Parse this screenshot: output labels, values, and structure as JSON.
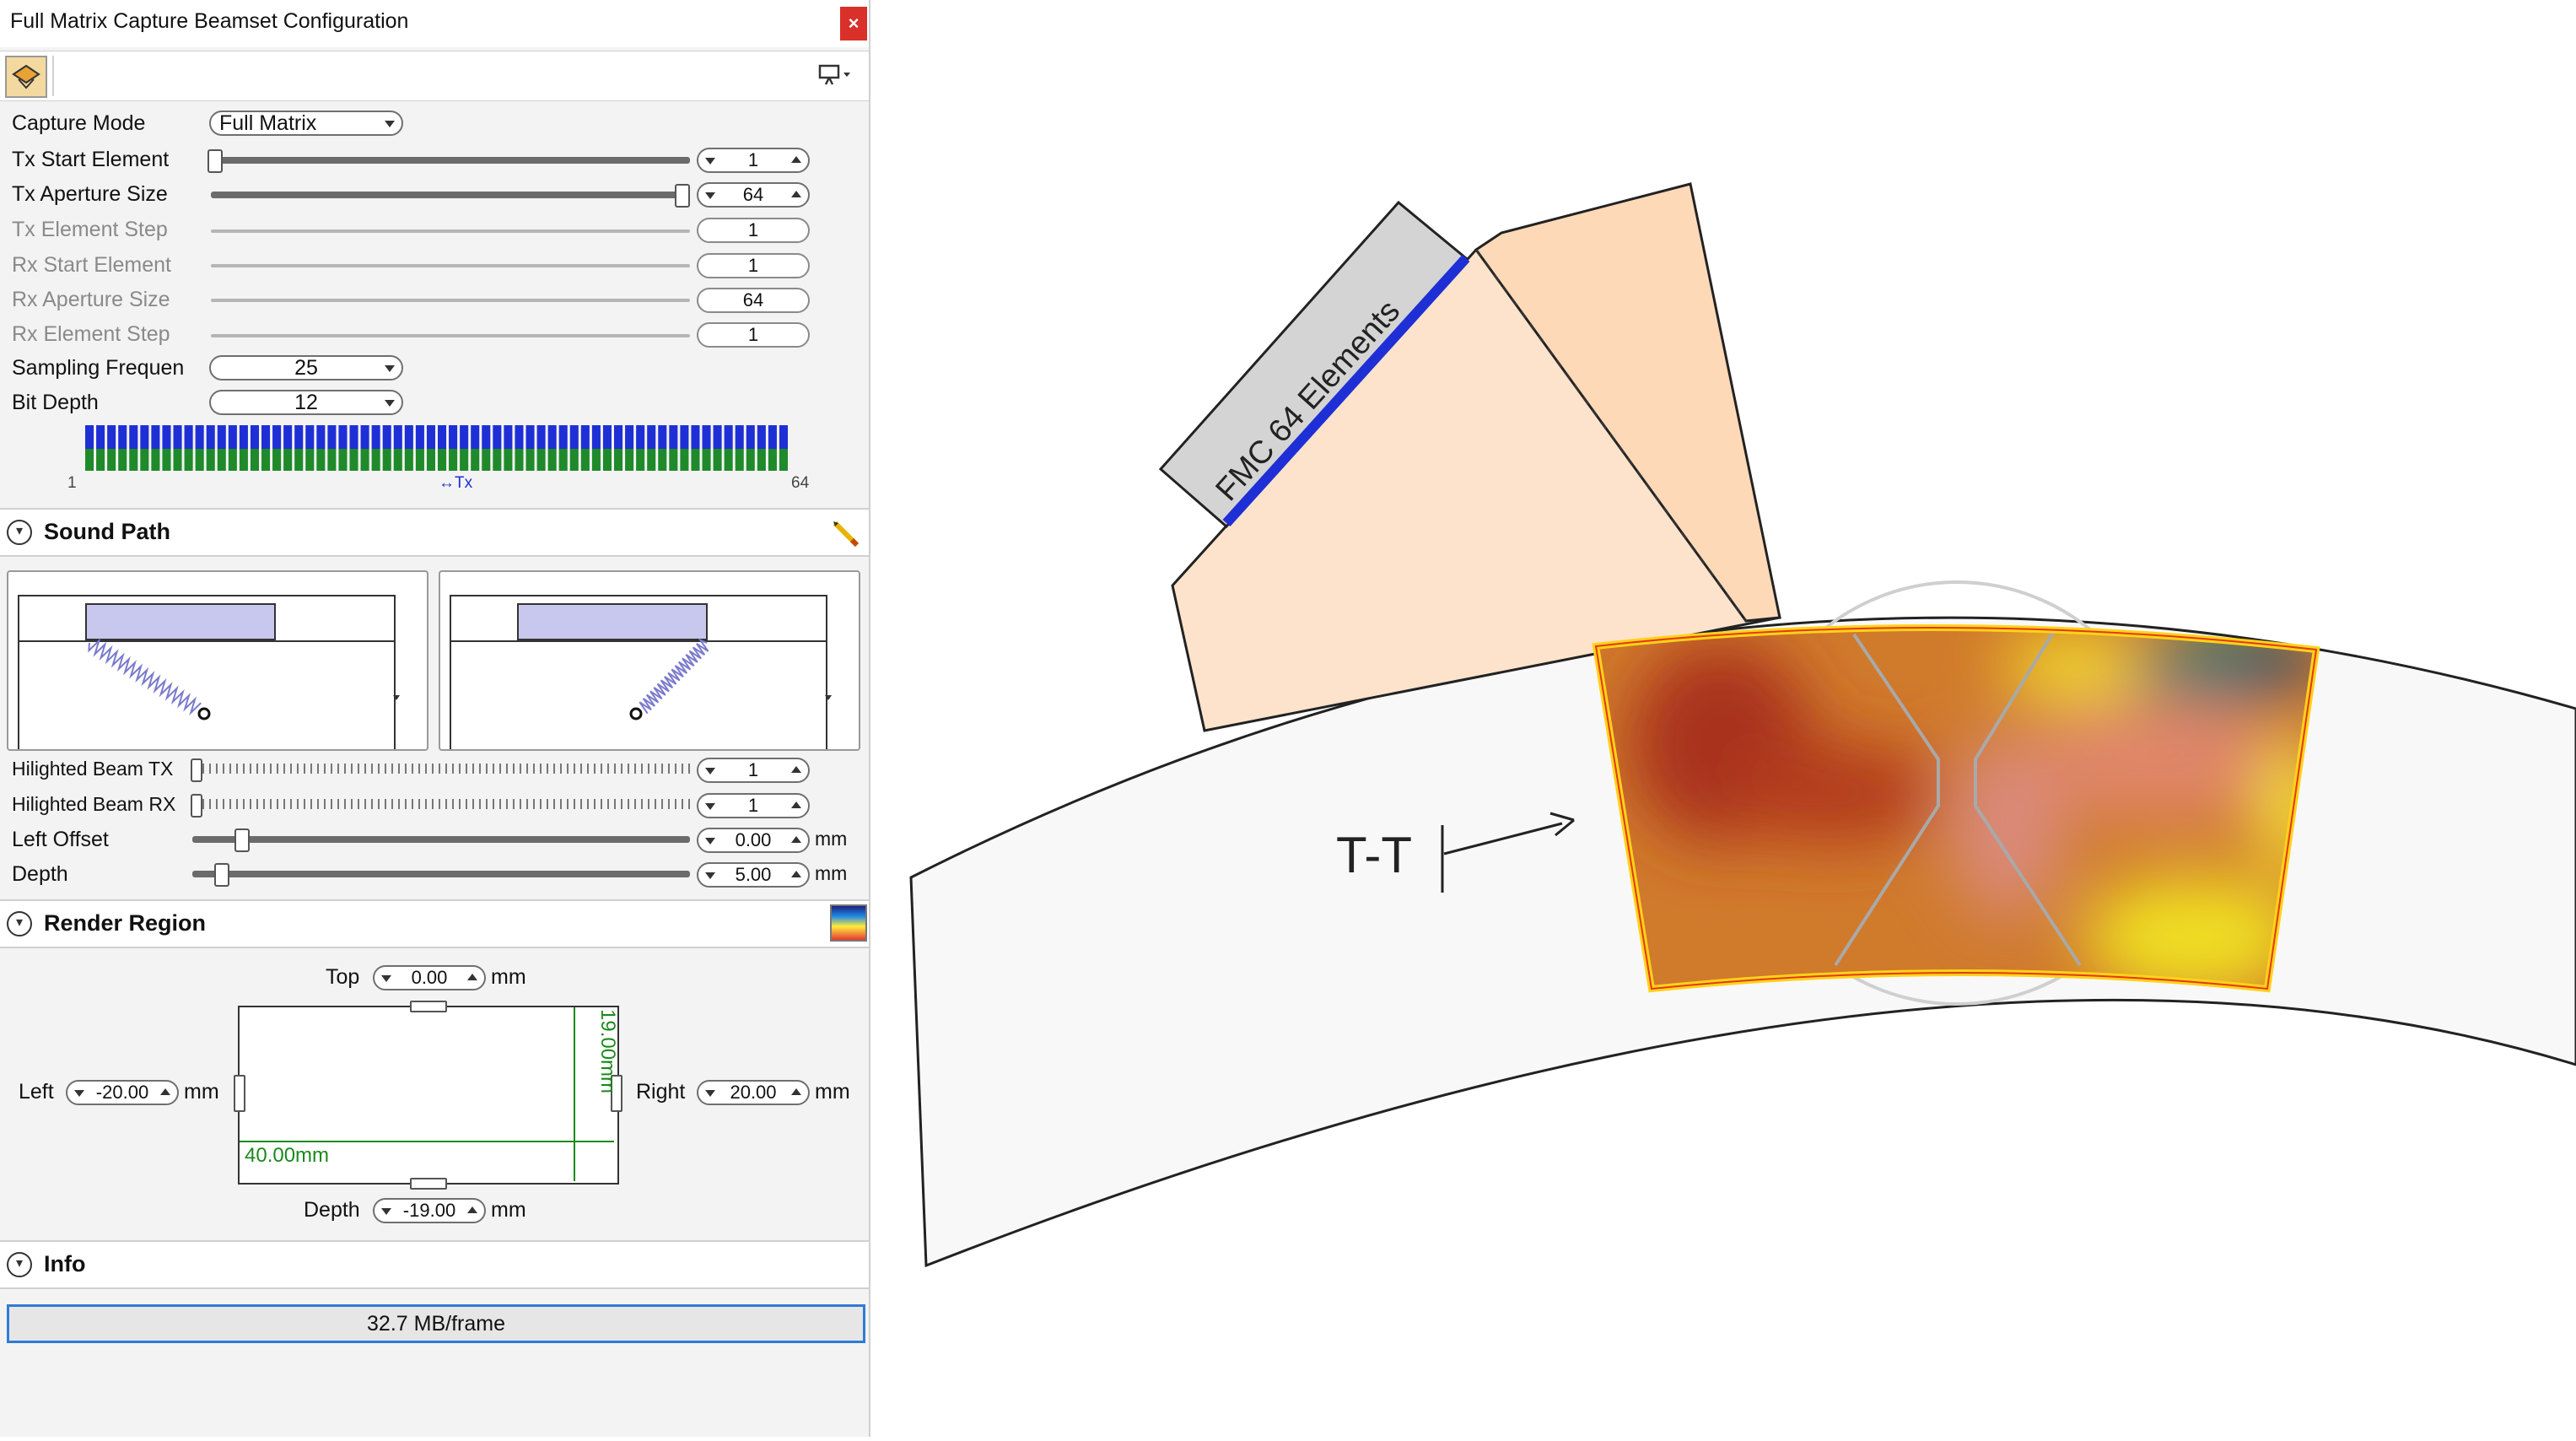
{
  "window": {
    "title": "Full Matrix Capture Beamset Configuration",
    "close_label": "×"
  },
  "toolbar": {
    "main_icon": "beamset-icon",
    "right_icon": "display-options-icon"
  },
  "capture": {
    "capture_mode": {
      "label": "Capture Mode",
      "value": "Full Matrix"
    },
    "tx_start": {
      "label": "Tx Start Element",
      "value": "1"
    },
    "tx_aperture": {
      "label": "Tx Aperture Size",
      "value": "64"
    },
    "tx_step": {
      "label": "Tx Element Step",
      "value": "1"
    },
    "rx_start": {
      "label": "Rx Start Element",
      "value": "1"
    },
    "rx_aperture": {
      "label": "Rx Aperture Size",
      "value": "64"
    },
    "rx_step": {
      "label": "Rx Element Step",
      "value": "1"
    },
    "sampling": {
      "label": "Sampling Frequen",
      "value": "25"
    },
    "bit_depth": {
      "label": "Bit Depth",
      "value": "12"
    },
    "element_strip": {
      "start": "1",
      "end": "64",
      "mid_label": "Tx",
      "element_count": 64,
      "tx_color": "#1f2fd6",
      "rx_color": "#1f8a2a"
    }
  },
  "sound_path": {
    "title": "Sound Path",
    "highlighted_tx": {
      "label": "Hilighted Beam TX",
      "value": "1"
    },
    "highlighted_rx": {
      "label": "Hilighted Beam RX",
      "value": "1"
    },
    "left_offset": {
      "label": "Left Offset",
      "value": "0.00",
      "unit": "mm"
    },
    "depth": {
      "label": "Depth",
      "value": "5.00",
      "unit": "mm"
    }
  },
  "render_region": {
    "title": "Render Region",
    "top": {
      "label": "Top",
      "value": "0.00",
      "unit": "mm"
    },
    "left": {
      "label": "Left",
      "value": "-20.00",
      "unit": "mm"
    },
    "right": {
      "label": "Right",
      "value": "20.00",
      "unit": "mm"
    },
    "depth": {
      "label": "Depth",
      "value": "-19.00",
      "unit": "mm"
    },
    "width_readout": "40.00mm",
    "height_readout": "19.00mm",
    "accent": "#1a8a1a"
  },
  "info": {
    "title": "Info",
    "frame_size": "32.7 MB/frame"
  },
  "view": {
    "probe_label": "FMC 64 Elements",
    "section_label": "T-T",
    "colors": {
      "wedge": "#fde3cc",
      "probe": "#d4d4d4",
      "elements": "#1f2fd6",
      "pipe": "#f8f8f8",
      "region_border": "#ffd21a"
    }
  }
}
